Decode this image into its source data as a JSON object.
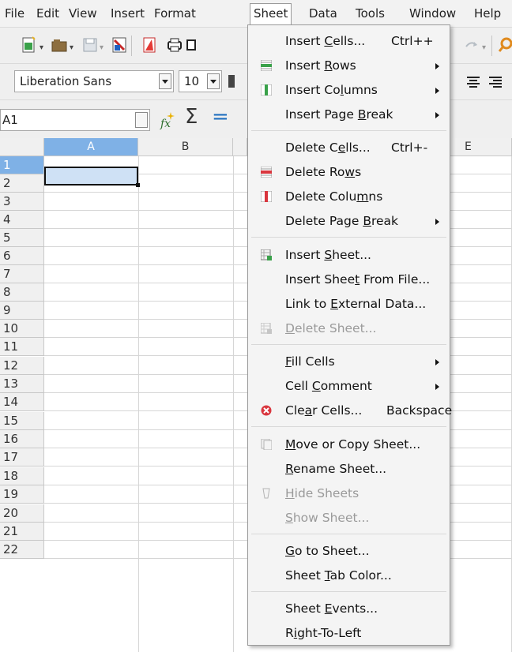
{
  "menubar": {
    "items": [
      {
        "label": "File"
      },
      {
        "label": "Edit"
      },
      {
        "label": "View"
      },
      {
        "label": "Insert"
      },
      {
        "label": "Format"
      },
      {
        "label": "Sheet"
      },
      {
        "label": "Data"
      },
      {
        "label": "Tools"
      },
      {
        "label": "Window"
      },
      {
        "label": "Help"
      }
    ]
  },
  "format_bar": {
    "font_name": "Liberation Sans",
    "font_size": "10"
  },
  "formula_bar": {
    "cell_ref": "A1",
    "sum_symbol": "Σ",
    "equals_symbol": "="
  },
  "grid": {
    "columns": [
      "A",
      "B",
      "E"
    ],
    "rows": [
      "1",
      "2",
      "3",
      "4",
      "5",
      "6",
      "7",
      "8",
      "9",
      "10",
      "11",
      "12",
      "13",
      "14",
      "15",
      "16",
      "17",
      "18",
      "19",
      "20",
      "21",
      "22"
    ],
    "selected_cell": "A1"
  },
  "sheet_menu": {
    "items": [
      {
        "pre": "Insert ",
        "ul": "C",
        "post": "ells...",
        "shortcut": "Ctrl++",
        "icon": "none"
      },
      {
        "pre": "Insert ",
        "ul": "R",
        "post": "ows",
        "submenu": true,
        "icon": "insert-rows-icon"
      },
      {
        "pre": "Insert Co",
        "ul": "l",
        "post": "umns",
        "submenu": true,
        "icon": "insert-columns-icon"
      },
      {
        "pre": "Insert Page ",
        "ul": "B",
        "post": "reak",
        "submenu": true,
        "icon": "none"
      },
      {
        "pre": "Delete C",
        "ul": "e",
        "post": "lls...",
        "shortcut": "Ctrl+-",
        "icon": "none"
      },
      {
        "pre": "Delete Ro",
        "ul": "w",
        "post": "s",
        "icon": "delete-rows-icon"
      },
      {
        "pre": "Delete Colu",
        "ul": "m",
        "post": "ns",
        "icon": "delete-columns-icon"
      },
      {
        "pre": "Delete Page ",
        "ul": "B",
        "post": "reak",
        "submenu": true,
        "icon": "none"
      },
      {
        "pre": "Insert ",
        "ul": "S",
        "post": "heet...",
        "icon": "insert-sheet-icon"
      },
      {
        "pre": "Insert Shee",
        "ul": "t",
        "post": " From File...",
        "icon": "none"
      },
      {
        "pre": "Link to ",
        "ul": "E",
        "post": "xternal Data...",
        "icon": "none"
      },
      {
        "pre": "",
        "ul": "D",
        "post": "elete Sheet...",
        "disabled": true,
        "icon": "delete-sheet-icon"
      },
      {
        "pre": "",
        "ul": "F",
        "post": "ill Cells",
        "submenu": true,
        "icon": "none"
      },
      {
        "pre": "Cell ",
        "ul": "C",
        "post": "omment",
        "submenu": true,
        "icon": "none"
      },
      {
        "pre": "Cle",
        "ul": "a",
        "post": "r Cells...",
        "shortcut": "Backspace",
        "icon": "clear-cells-icon"
      },
      {
        "pre": "",
        "ul": "M",
        "post": "ove or Copy Sheet...",
        "icon": "move-copy-sheet-icon"
      },
      {
        "pre": "",
        "ul": "R",
        "post": "ename Sheet...",
        "icon": "none"
      },
      {
        "pre": "",
        "ul": "H",
        "post": "ide Sheets",
        "disabled": true,
        "icon": "hide-sheets-icon"
      },
      {
        "pre": "",
        "ul": "S",
        "post": "how Sheet...",
        "disabled": true,
        "icon": "none"
      },
      {
        "pre": "",
        "ul": "G",
        "post": "o to Sheet...",
        "icon": "none"
      },
      {
        "pre": "Sheet ",
        "ul": "T",
        "post": "ab Color...",
        "icon": "none"
      },
      {
        "pre": "Sheet ",
        "ul": "E",
        "post": "vents...",
        "icon": "none"
      },
      {
        "pre": "R",
        "ul": "i",
        "post": "ght-To-Left",
        "icon": "none"
      }
    ]
  },
  "colors": {
    "menu_bg": "#f4f4f4",
    "selection_header": "#7fb1e6",
    "selected_cell": "#cfe1f5",
    "clear_icon": "#d9363e"
  }
}
